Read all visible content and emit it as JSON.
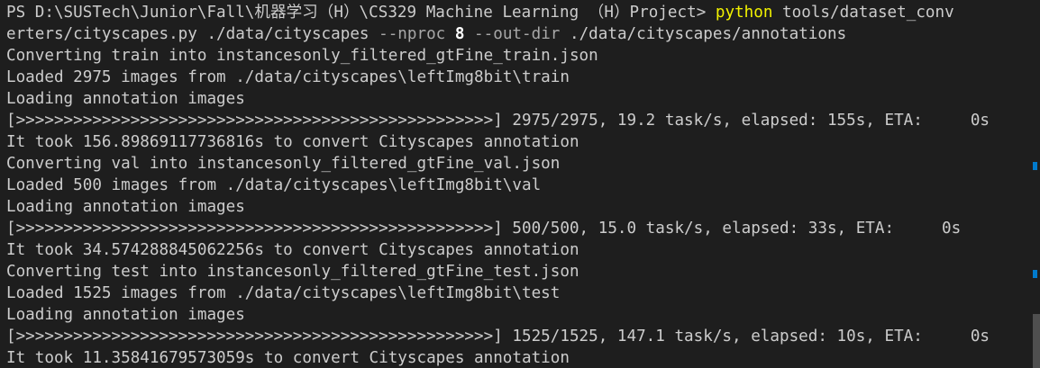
{
  "terminal": {
    "lines": [
      [
        {
          "t": "PS D:\\SUSTech\\Junior\\Fall\\机器学习（H）\\CS329 Machine Learning （H）Project> ",
          "k": "plain"
        },
        {
          "t": "python",
          "k": "cmd"
        },
        {
          "t": " tools/dataset_conv",
          "k": "plain"
        }
      ],
      [
        {
          "t": "erters/cityscapes.py ./data/cityscapes ",
          "k": "plain"
        },
        {
          "t": "--nproc",
          "k": "flag"
        },
        {
          "t": " ",
          "k": "plain"
        },
        {
          "t": "8",
          "k": "num"
        },
        {
          "t": " ",
          "k": "plain"
        },
        {
          "t": "--out-dir",
          "k": "flag"
        },
        {
          "t": " ./data/cityscapes/annotations",
          "k": "plain"
        }
      ],
      [
        {
          "t": "Converting train into instancesonly_filtered_gtFine_train.json",
          "k": "plain"
        }
      ],
      [
        {
          "t": "Loaded 2975 images from ./data/cityscapes\\leftImg8bit\\train",
          "k": "plain"
        }
      ],
      [
        {
          "t": "Loading annotation images",
          "k": "plain"
        }
      ],
      [
        {
          "t": "[>>>>>>>>>>>>>>>>>>>>>>>>>>>>>>>>>>>>>>>>>>>>>>>>>>] 2975/2975, 19.2 task/s, elapsed: 155s, ETA:     0s",
          "k": "plain"
        }
      ],
      [
        {
          "t": "It took 156.89869117736816s to convert Cityscapes annotation",
          "k": "plain"
        }
      ],
      [
        {
          "t": "Converting val into instancesonly_filtered_gtFine_val.json",
          "k": "plain"
        }
      ],
      [
        {
          "t": "Loaded 500 images from ./data/cityscapes\\leftImg8bit\\val",
          "k": "plain"
        }
      ],
      [
        {
          "t": "Loading annotation images",
          "k": "plain"
        }
      ],
      [
        {
          "t": "[>>>>>>>>>>>>>>>>>>>>>>>>>>>>>>>>>>>>>>>>>>>>>>>>>>] 500/500, 15.0 task/s, elapsed: 33s, ETA:     0s",
          "k": "plain"
        }
      ],
      [
        {
          "t": "It took 34.574288845062256s to convert Cityscapes annotation",
          "k": "plain"
        }
      ],
      [
        {
          "t": "Converting test into instancesonly_filtered_gtFine_test.json",
          "k": "plain"
        }
      ],
      [
        {
          "t": "Loaded 1525 images from ./data/cityscapes\\leftImg8bit\\test",
          "k": "plain"
        }
      ],
      [
        {
          "t": "Loading annotation images",
          "k": "plain"
        }
      ],
      [
        {
          "t": "[>>>>>>>>>>>>>>>>>>>>>>>>>>>>>>>>>>>>>>>>>>>>>>>>>>] 1525/1525, 147.1 task/s, elapsed: 10s, ETA:     0s",
          "k": "plain"
        }
      ],
      [
        {
          "t": "It took 11.35841679573059s to convert Cityscapes annotation",
          "k": "plain"
        }
      ]
    ]
  },
  "colors": {
    "background": "#1e1e1e",
    "foreground": "#cccccc",
    "command": "#f2f200",
    "flag": "#a8a8a8",
    "number": "#ffffff",
    "scroll_marker": "#007acc",
    "scrollbar_thumb": "#4f4f4f"
  }
}
